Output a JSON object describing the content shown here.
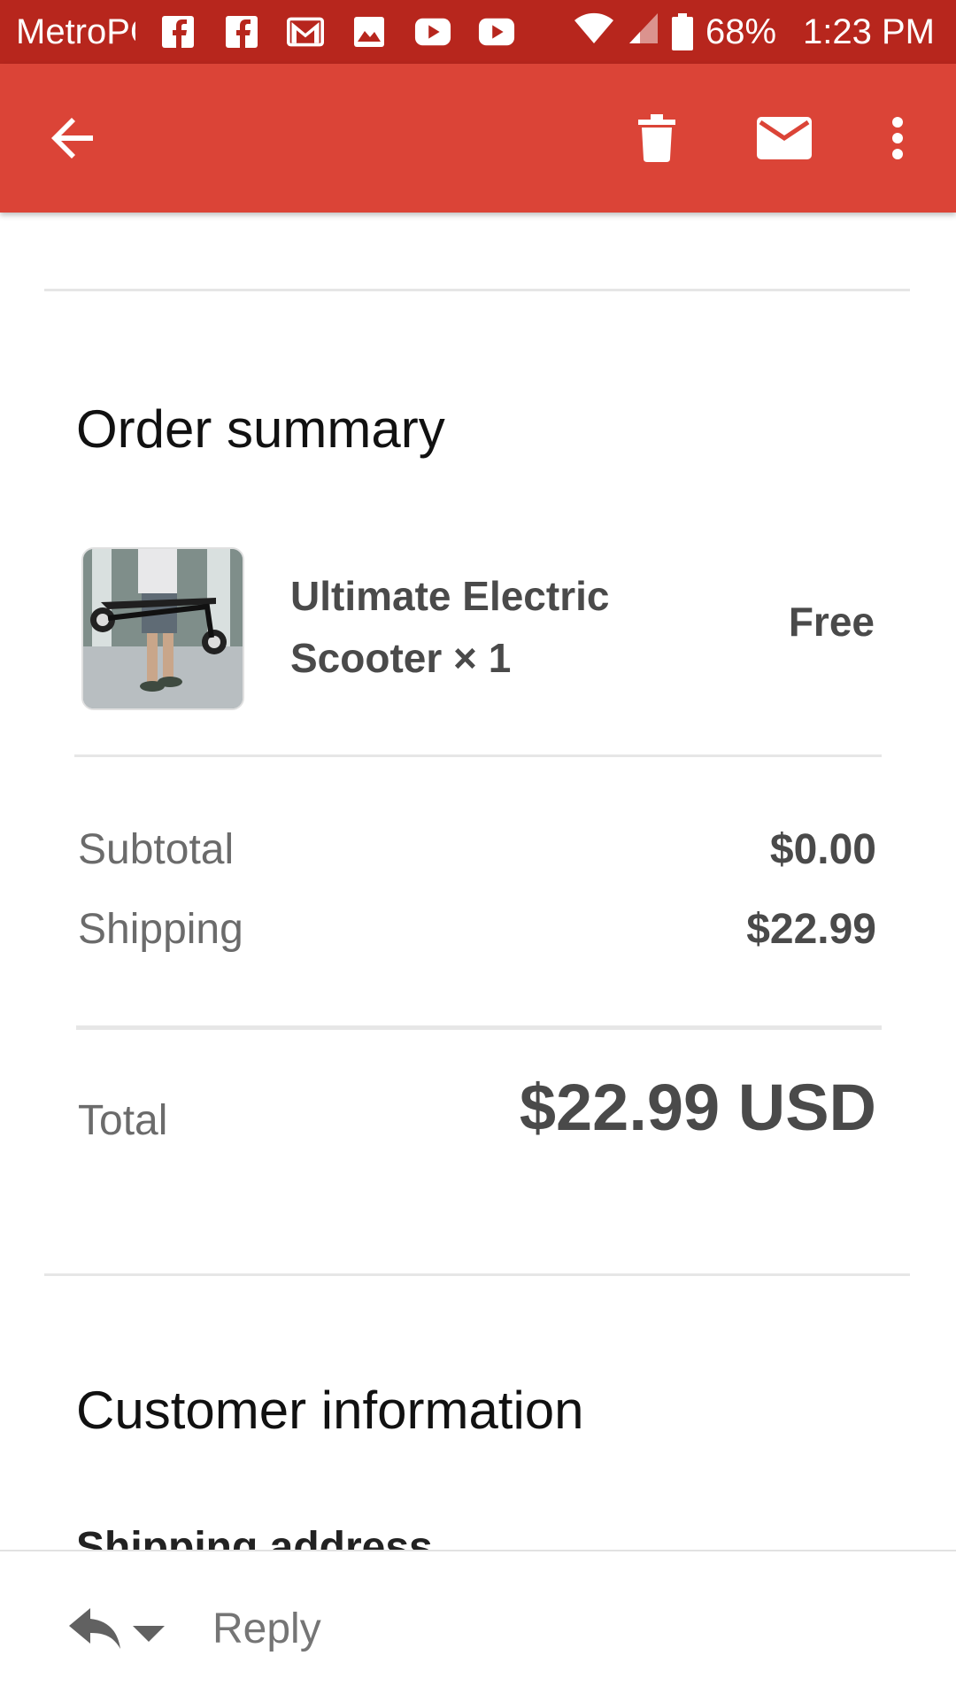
{
  "status_bar": {
    "carrier": "MetroPCS",
    "battery": "68%",
    "time": "1:23 PM",
    "icons": [
      "facebook-icon",
      "facebook-icon",
      "gmail-icon",
      "image-icon",
      "youtube-icon",
      "youtube-icon"
    ]
  },
  "app_bar": {
    "color": "#db4437",
    "actions": [
      "back-arrow-icon",
      "delete-icon",
      "mail-icon",
      "more-vert-icon"
    ]
  },
  "order_summary": {
    "title": "Order summary",
    "item": {
      "name": "Ultimate Electric Scooter × 1",
      "price": "Free"
    },
    "subtotal_label": "Subtotal",
    "subtotal_value": "$0.00",
    "shipping_label": "Shipping",
    "shipping_value": "$22.99",
    "total_label": "Total",
    "total_value": "$22.99 USD"
  },
  "customer_info": {
    "title": "Customer information",
    "shipping_address_label": "Shipping address"
  },
  "bottom_bar": {
    "reply_label": "Reply"
  }
}
